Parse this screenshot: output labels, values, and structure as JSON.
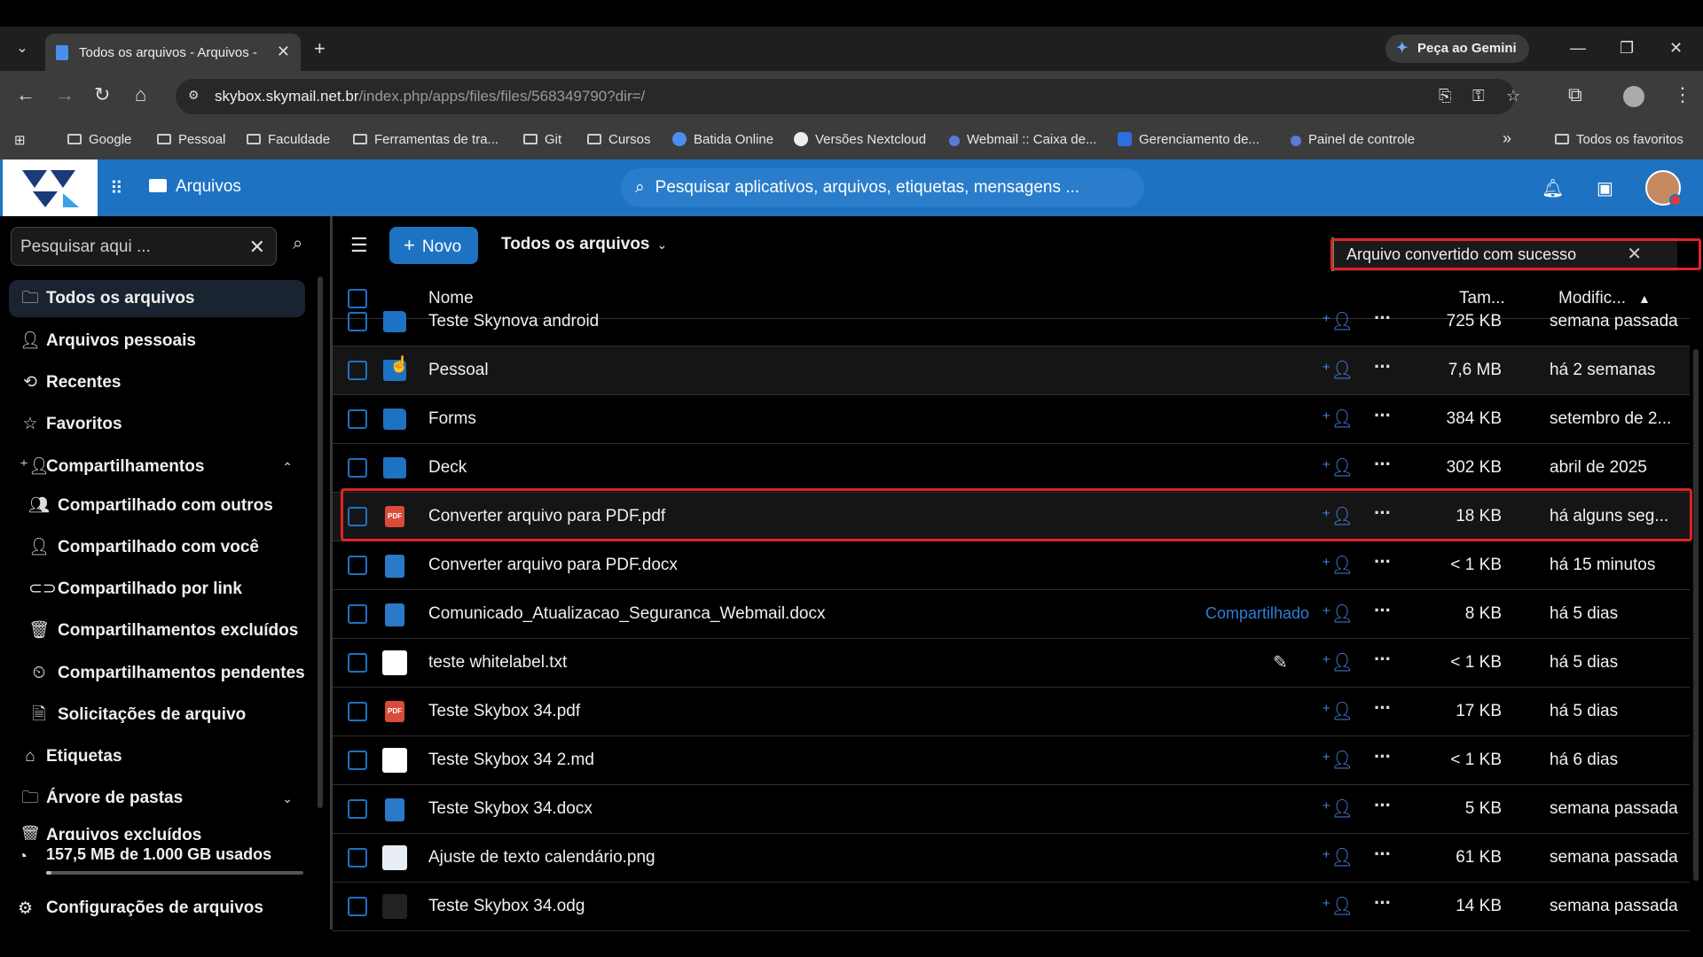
{
  "browser": {
    "tab_title": "Todos os arquivos - Arquivos - ",
    "gemini_label": "Peça ao Gemini",
    "url_host": "skybox.skymail.net.br",
    "url_path": "/index.php/apps/files/files/568349790?dir=/",
    "bookmarks": [
      "Google",
      "Pessoal",
      "Faculdade",
      "Ferramentas de tra...",
      "Git",
      "Cursos",
      "Batida Online",
      "Versões Nextcloud",
      "Webmail :: Caixa de...",
      "Gerenciamento de...",
      "Painel de controle",
      "Todos os favoritos"
    ],
    "bookmarks_more": "»"
  },
  "header": {
    "app_name": "Arquivos",
    "search_placeholder": "Pesquisar aplicativos, arquivos, etiquetas, mensagens ..."
  },
  "sidebar": {
    "search_placeholder": "Pesquisar aqui ...",
    "items": [
      {
        "label": "Todos os arquivos",
        "icon": "folder-icon"
      },
      {
        "label": "Arquivos pessoais",
        "icon": "user-icon"
      },
      {
        "label": "Recentes",
        "icon": "history-icon"
      },
      {
        "label": "Favoritos",
        "icon": "star-icon"
      },
      {
        "label": "Compartilhamentos",
        "icon": "share-icon"
      },
      {
        "label": "Compartilhado com outros",
        "icon": "users-icon"
      },
      {
        "label": "Compartilhado com você",
        "icon": "user-icon"
      },
      {
        "label": "Compartilhado por link",
        "icon": "link-icon"
      },
      {
        "label": "Compartilhamentos excluídos",
        "icon": "trash-icon"
      },
      {
        "label": "Compartilhamentos pendentes",
        "icon": "pending-icon"
      },
      {
        "label": "Solicitações de arquivo",
        "icon": "file-request-icon"
      },
      {
        "label": "Etiquetas",
        "icon": "tag-icon"
      },
      {
        "label": "Árvore de pastas",
        "icon": "folder-tree-icon"
      },
      {
        "label": "Arquivos excluídos",
        "icon": "trash-icon"
      }
    ],
    "quota": "157,5 MB de 1.000 GB usados",
    "quota_fraction": 0.0002,
    "settings": "Configurações de arquivos"
  },
  "toolbar": {
    "new_label": "Novo",
    "breadcrumb": "Todos os arquivos"
  },
  "toast": {
    "message": "Arquivo convertido com sucesso"
  },
  "table": {
    "col_name": "Nome",
    "col_size": "Tam...",
    "col_modified": "Modific...",
    "rows": [
      {
        "name": "Teste Skynova android",
        "type": "folder",
        "size": "725 KB",
        "modified": "semana passada"
      },
      {
        "name": "Pessoal",
        "type": "folder",
        "size": "7,6 MB",
        "modified": "há 2 semanas"
      },
      {
        "name": "Forms",
        "type": "folder",
        "size": "384 KB",
        "modified": "setembro de 2..."
      },
      {
        "name": "Deck",
        "type": "folder",
        "size": "302 KB",
        "modified": "abril de 2025"
      },
      {
        "name": "Converter arquivo para PDF.pdf",
        "type": "pdf",
        "size": "18 KB",
        "modified": "há alguns seg..."
      },
      {
        "name": "Converter arquivo para PDF.docx",
        "type": "doc",
        "size": "< 1 KB",
        "modified": "há 15 minutos"
      },
      {
        "name": "Comunicado_Atualizacao_Seguranca_Webmail.docx",
        "type": "doc",
        "size": "8 KB",
        "modified": "há 5 dias",
        "shared": "Compartilhado"
      },
      {
        "name": "teste whitelabel.txt",
        "type": "txt",
        "size": "< 1 KB",
        "modified": "há 5 dias",
        "editable": true
      },
      {
        "name": "Teste Skybox 34.pdf",
        "type": "pdf",
        "size": "17 KB",
        "modified": "há 5 dias"
      },
      {
        "name": "Teste Skybox 34 2.md",
        "type": "txt",
        "size": "< 1 KB",
        "modified": "há 6 dias"
      },
      {
        "name": "Teste Skybox 34.docx",
        "type": "doc",
        "size": "5 KB",
        "modified": "semana passada"
      },
      {
        "name": "Ajuste de texto calendário.png",
        "type": "img",
        "size": "61 KB",
        "modified": "semana passada"
      },
      {
        "name": "Teste Skybox 34.odg",
        "type": "odg",
        "size": "14 KB",
        "modified": "semana passada"
      }
    ]
  }
}
